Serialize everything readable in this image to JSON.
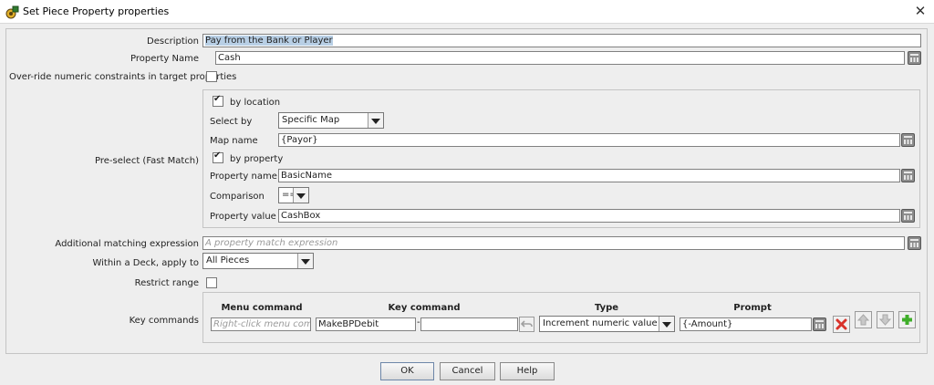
{
  "window": {
    "title": "Set Piece Property properties",
    "close_glyph": "✕"
  },
  "form": {
    "description_label": "Description",
    "description_value": "Pay from the Bank or Player",
    "property_name_label": "Property Name",
    "property_name_value": "Cash",
    "override_label": "Over-ride numeric constraints in target properties",
    "override_checked": false,
    "preselect_label": "Pre-select (Fast Match)",
    "preselect": {
      "by_location_label": "by location",
      "by_location_checked": true,
      "select_by_label": "Select by",
      "select_by_value": "Specific Map",
      "map_name_label": "Map name",
      "map_name_value": "{Payor}",
      "by_property_label": "by property",
      "by_property_checked": true,
      "property_name_label": "Property name",
      "property_name_value": "BasicName",
      "comparison_label": "Comparison",
      "comparison_value": "==",
      "property_value_label": "Property value",
      "property_value_value": "CashBox"
    },
    "additional_label": "Additional matching expression",
    "additional_placeholder": "A property match expression",
    "within_deck_label": "Within a Deck, apply to",
    "within_deck_value": "All Pieces",
    "restrict_range_label": "Restrict range",
    "restrict_range_checked": false,
    "key_commands_label": "Key commands",
    "key_commands": {
      "headers": {
        "menu": "Menu command",
        "key": "Key command",
        "type": "Type",
        "prompt": "Prompt"
      },
      "row": {
        "menu_placeholder": "Right-click menu command",
        "key_value": "MakeBPDebit",
        "key_dash": "-",
        "key_second": "",
        "type_value": "Increment numeric value",
        "prompt_value": "{-Amount}"
      }
    }
  },
  "buttons": {
    "ok": "OK",
    "cancel": "Cancel",
    "help": "Help"
  },
  "colors": {
    "delete": "#d9322a",
    "add": "#3fae2a",
    "selection": "#b8cfe5"
  },
  "icons": [
    "app-icon",
    "calculator-icon",
    "delete-icon",
    "arrow-up-icon",
    "arrow-down-icon",
    "add-icon",
    "undo-icon",
    "dropdown-arrow-icon"
  ]
}
